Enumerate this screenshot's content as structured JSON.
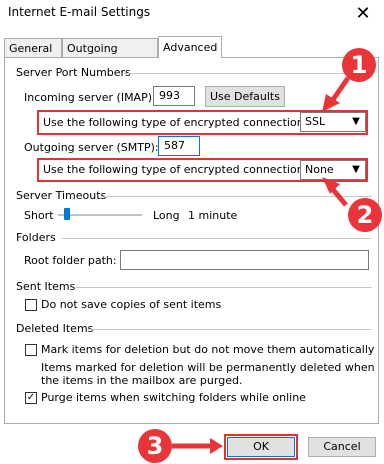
{
  "window": {
    "title": "Internet E-mail Settings",
    "close_label": "✕"
  },
  "tabs": [
    {
      "label": "General"
    },
    {
      "label": "Outgoing Server"
    },
    {
      "label": "Advanced"
    }
  ],
  "server_ports": {
    "section_label": "Server Port Numbers",
    "incoming_label": "Incoming server (IMAP):",
    "incoming_value": "993",
    "use_defaults_label": "Use Defaults",
    "incoming_encryption_label": "Use the following type of encrypted connection:",
    "incoming_encryption_value": "SSL",
    "outgoing_label": "Outgoing server (SMTP):",
    "outgoing_value": "587",
    "outgoing_encryption_label": "Use the following type of encrypted connection:",
    "outgoing_encryption_value": "None"
  },
  "timeouts": {
    "section_label": "Server Timeouts",
    "short_label": "Short",
    "long_label": "Long",
    "value_label": "1 minute",
    "level_fraction": 0.0
  },
  "folders": {
    "section_label": "Folders",
    "root_label": "Root folder path:",
    "root_value": ""
  },
  "sent_items": {
    "section_label": "Sent Items",
    "no_save_label": "Do not save copies of sent items",
    "no_save_checked": false
  },
  "deleted_items": {
    "section_label": "Deleted Items",
    "mark_label": "Mark items for deletion but do not move them automatically",
    "mark_checked": false,
    "note_line1": "Items marked for deletion will be permanently deleted when",
    "note_line2": "the items in the mailbox are purged.",
    "purge_label": "Purge items when switching folders while online",
    "purge_checked": true
  },
  "footer": {
    "ok_label": "OK",
    "cancel_label": "Cancel"
  },
  "annotations": {
    "badge1": "1",
    "badge2": "2",
    "badge3": "3"
  },
  "colors": {
    "annotation": "#e9343a",
    "slider_accent": "#0078d7"
  }
}
